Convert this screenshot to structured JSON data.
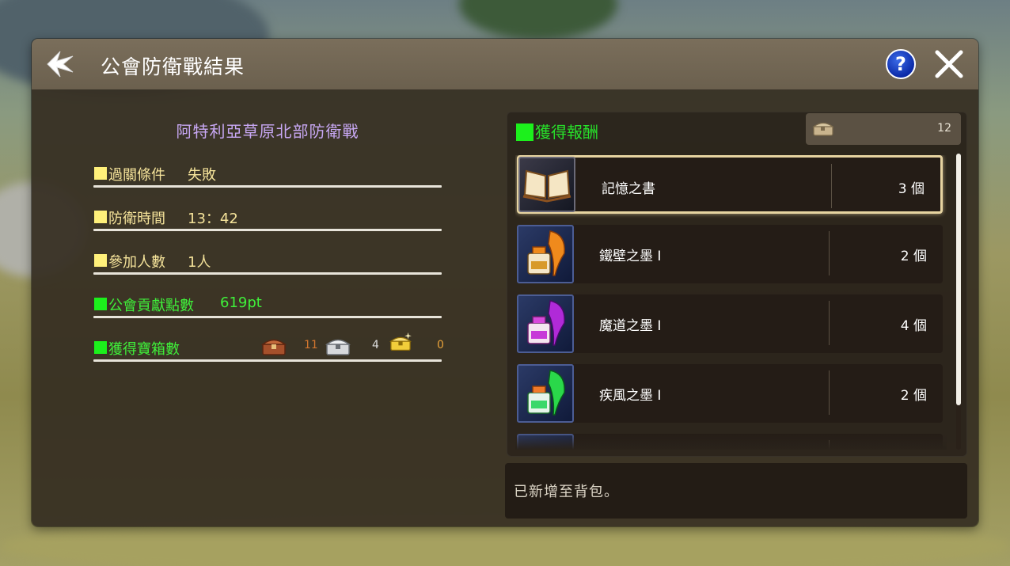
{
  "window": {
    "title": "公會防衛戰結果"
  },
  "stage_name": "阿特利亞草原北部防衛戰",
  "stats": {
    "condition": {
      "label": "過關條件",
      "value": "失敗"
    },
    "time": {
      "label": "防衛時間",
      "value": "13：42"
    },
    "participants": {
      "label": "參加人數",
      "value": "1人"
    },
    "contribution": {
      "label": "公會貢獻點數",
      "value": "619pt"
    },
    "chests": {
      "label": "獲得寶箱數",
      "bronze": "11",
      "silver": "4",
      "gold": "0"
    }
  },
  "rewards": {
    "title": "獲得報酬",
    "total": "12",
    "items": [
      {
        "name": "記憶之書",
        "qty": "3 個"
      },
      {
        "name": "鐵壁之墨 I",
        "qty": "2 個"
      },
      {
        "name": "魔道之墨 I",
        "qty": "4 個"
      },
      {
        "name": "疾風之墨 I",
        "qty": "2 個"
      }
    ]
  },
  "message": "已新增至背包。",
  "colors": {
    "yellow_bullet": "#fff07a",
    "green_bullet": "#1cf01c",
    "stat_text_yellow": "#f5e39a",
    "stat_text_green": "#3ff03a",
    "stage_name": "#c8a8f4"
  },
  "icons": {
    "back": "back-arrow-icon",
    "help": "help-icon",
    "close": "close-icon",
    "chest_bronze": "bronze-chest-icon",
    "chest_silver": "silver-chest-icon",
    "chest_gold": "gold-chest-icon",
    "book": "book-icon",
    "ink_orange": "orange-ink-quill-icon",
    "ink_purple": "purple-ink-quill-icon",
    "ink_green": "green-ink-quill-icon"
  }
}
